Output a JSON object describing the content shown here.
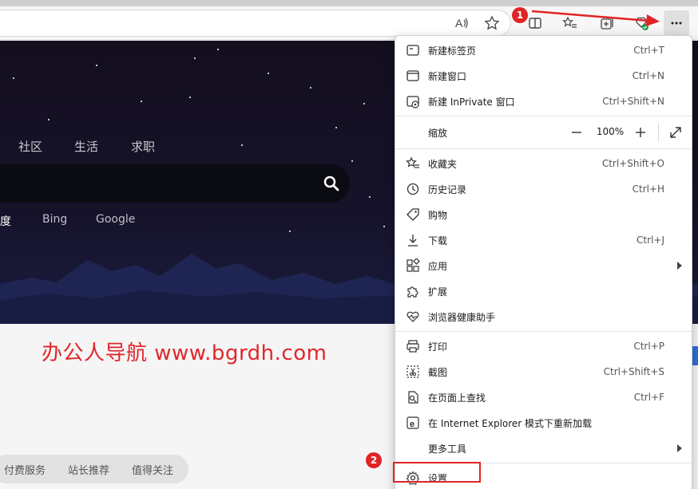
{
  "annotations": {
    "badge_1": "1",
    "badge_2": "2"
  },
  "hero": {
    "nav": [
      "社区",
      "生活",
      "求职"
    ],
    "engines": [
      "度",
      "Bing",
      "Google"
    ]
  },
  "page": {
    "brand_text": "办公人导航  www.bgrdh.com",
    "links": [
      "付费服务",
      "站长推荐",
      "值得关注"
    ]
  },
  "menu": {
    "new_tab": {
      "label": "新建标签页",
      "shortcut": "Ctrl+T"
    },
    "new_window": {
      "label": "新建窗口",
      "shortcut": "Ctrl+N"
    },
    "new_inprivate": {
      "label": "新建 InPrivate 窗口",
      "shortcut": "Ctrl+Shift+N"
    },
    "zoom": {
      "label": "缩放",
      "value": "100%"
    },
    "favorites": {
      "label": "收藏夹",
      "shortcut": "Ctrl+Shift+O"
    },
    "history": {
      "label": "历史记录",
      "shortcut": "Ctrl+H"
    },
    "shopping": {
      "label": "购物"
    },
    "downloads": {
      "label": "下载",
      "shortcut": "Ctrl+J"
    },
    "apps": {
      "label": "应用"
    },
    "extensions": {
      "label": "扩展"
    },
    "browser_health": {
      "label": "浏览器健康助手"
    },
    "print": {
      "label": "打印",
      "shortcut": "Ctrl+P"
    },
    "screenshot": {
      "label": "截图",
      "shortcut": "Ctrl+Shift+S"
    },
    "find": {
      "label": "在页面上查找",
      "shortcut": "Ctrl+F"
    },
    "ie_mode": {
      "label": "在 Internet Explorer 模式下重新加载"
    },
    "more_tools": {
      "label": "更多工具"
    },
    "settings": {
      "label": "设置"
    }
  },
  "colors": {
    "annotation_red": "#e02424",
    "brand_red": "#e0262a"
  }
}
